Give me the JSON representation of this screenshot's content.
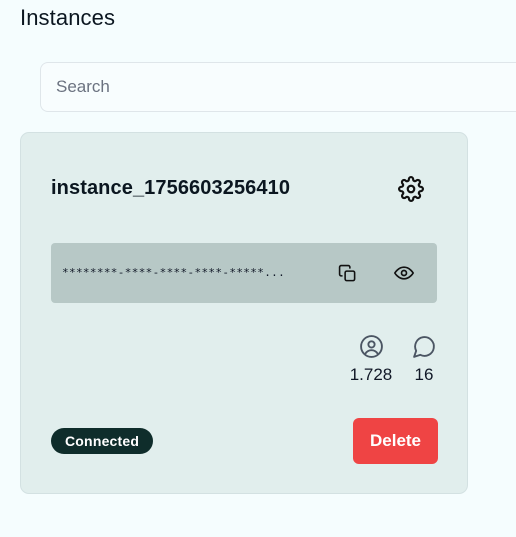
{
  "page": {
    "title": "Instances"
  },
  "search": {
    "placeholder": "Search",
    "value": ""
  },
  "instance": {
    "name": "instance_1756603256410",
    "token_masked": "********-****-****-****-*****...",
    "stats": {
      "contacts": "1.728",
      "messages": "16"
    },
    "status": "Connected",
    "delete_label": "Delete"
  },
  "icons": {
    "settings": "gear-icon",
    "copy": "copy-icon",
    "reveal": "eye-icon",
    "contacts": "user-circle-icon",
    "messages": "chat-bubble-icon"
  },
  "colors": {
    "background": "#f5fdfe",
    "card": "#e1eeed",
    "token_bar": "#b7c8c6",
    "status_badge": "#0f2d2b",
    "delete": "#ef4444"
  }
}
